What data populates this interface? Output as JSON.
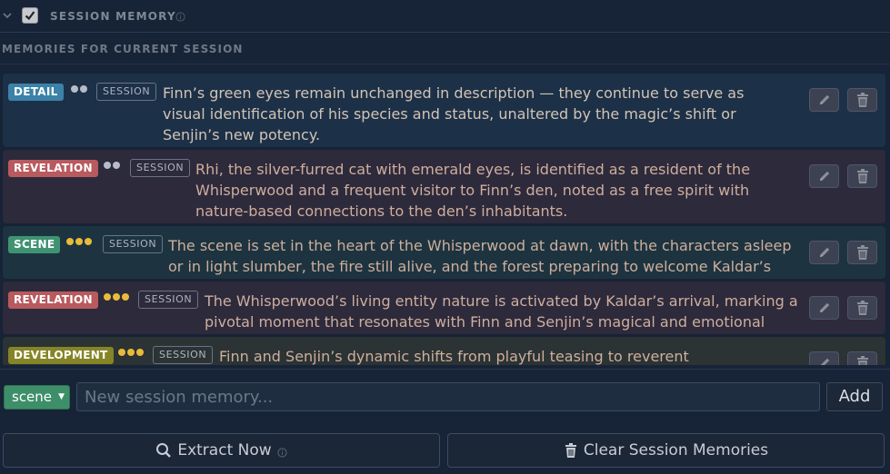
{
  "section": {
    "title": "SESSION MEMORY",
    "checked": true,
    "subheader": "MEMORIES FOR CURRENT SESSION"
  },
  "memories": [
    {
      "type": "DETAIL",
      "importance": 2,
      "scope": "SESSION",
      "text": "Finn’s green eyes remain unchanged in description — they continue to serve as visual identification of his species and status, unaltered by the magic’s shift or Senjin’s new potency."
    },
    {
      "type": "REVELATION",
      "importance": 2,
      "scope": "SESSION",
      "text": "Rhi, the silver-furred cat with emerald eyes, is identified as a resident of the Whisperwood and a frequent visitor to Finn’s den, noted as a free spirit with nature-based connections to the den’s inhabitants."
    },
    {
      "type": "SCENE",
      "importance": 3,
      "scope": "SESSION",
      "text": "The scene is set in the heart of the Whisperwood at dawn, with the characters asleep or in light slumber, the fire still alive, and the forest preparing to welcome Kaldar’s return."
    },
    {
      "type": "REVELATION",
      "importance": 3,
      "scope": "SESSION",
      "text": "The Whisperwood’s living entity nature is activated by Kaldar’s arrival, marking a pivotal moment that resonates with Finn and Senjin’s magical and emotional states."
    },
    {
      "type": "DEVELOPMENT",
      "importance": 3,
      "scope": "SESSION",
      "text": "Finn and Senjin’s dynamic shifts from playful teasing to reverent acknowledgment"
    }
  ],
  "add_row": {
    "selected_type": "scene",
    "placeholder": "New session memory...",
    "add_label": "Add"
  },
  "actions": {
    "extract_label": "Extract Now",
    "clear_label": "Clear Session Memories"
  },
  "colors": {
    "detail": "#3c82a8",
    "revelation": "#b85a5e",
    "scene": "#3f9372",
    "development": "#858427",
    "importance_dot_low": "#b8bcc6",
    "importance_dot_high": "#e8bc3a"
  },
  "icons": [
    "chevron-down-icon",
    "checkmark-icon",
    "info-icon",
    "pencil-icon",
    "trash-icon",
    "search-icon"
  ]
}
